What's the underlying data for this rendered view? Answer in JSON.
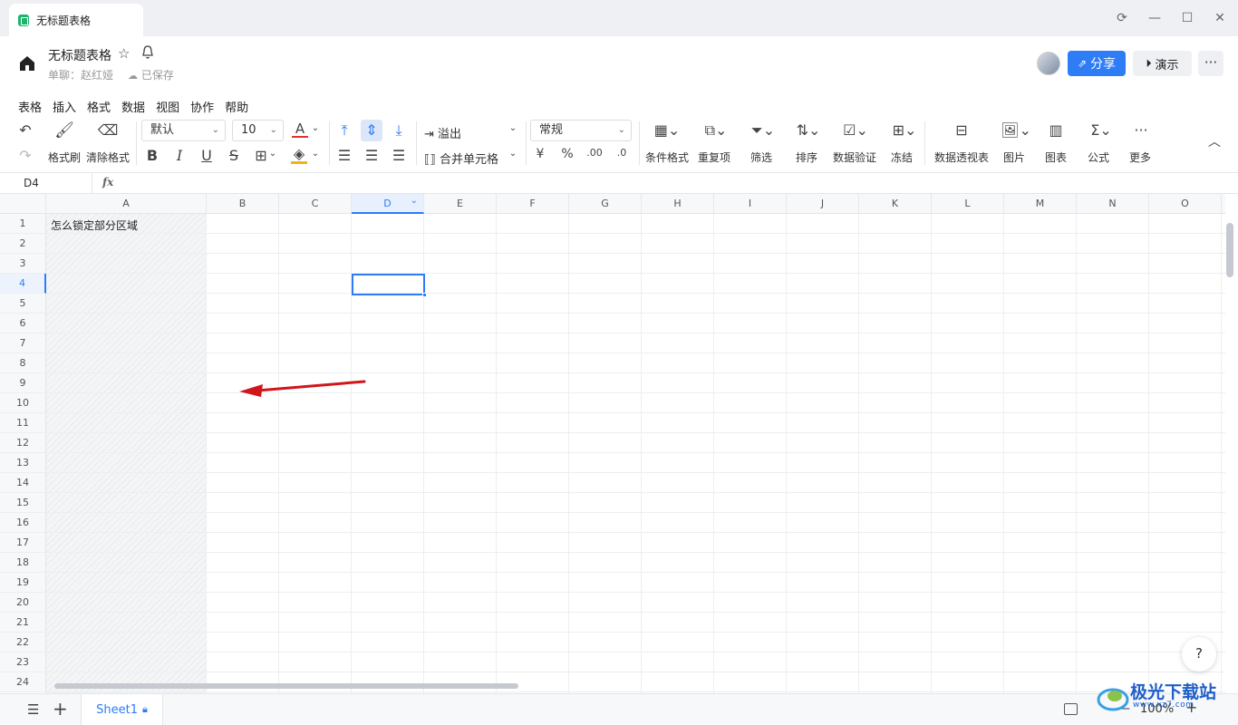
{
  "window": {
    "tab_title": "无标题表格",
    "controls": [
      "sync-icon",
      "minimize-icon",
      "maximize-icon",
      "close-icon"
    ]
  },
  "header": {
    "doc_title": "无标题表格",
    "owner": "单聊：赵红娅",
    "save_status": "已保存",
    "share_label": "分享",
    "present_label": "演示",
    "more_label": "···"
  },
  "menu": [
    "表格",
    "插入",
    "格式",
    "数据",
    "视图",
    "协作",
    "帮助"
  ],
  "toolbar": {
    "format_painter": "格式刷",
    "clear_format": "清除格式",
    "font_family": "默认",
    "font_size": "10",
    "overflow": "溢出",
    "merge": "合并单元格",
    "number_format": "常规",
    "currency": "¥",
    "percent": "%",
    "conditional_format": "条件格式",
    "duplicates": "重复项",
    "filter": "筛选",
    "sort": "排序",
    "data_validation": "数据验证",
    "freeze": "冻结",
    "pivot_table": "数据透视表",
    "image": "图片",
    "chart": "图表",
    "formula": "公式",
    "more": "更多",
    "font_color": "A"
  },
  "formula_bar": {
    "cell_ref": "D4",
    "fx": "fx",
    "value": ""
  },
  "sheet": {
    "columns": [
      "A",
      "B",
      "C",
      "D",
      "E",
      "F",
      "G",
      "H",
      "I",
      "J",
      "K",
      "L",
      "M",
      "N",
      "O"
    ],
    "rows": [
      "1",
      "2",
      "3",
      "4",
      "5",
      "6",
      "7",
      "8",
      "9",
      "10",
      "11",
      "12",
      "13",
      "14",
      "15",
      "16",
      "17",
      "18",
      "19",
      "20",
      "21",
      "22",
      "23",
      "24"
    ],
    "selected_cell": "D4",
    "frozen_columns": [
      "A"
    ],
    "cells": {
      "A1": "怎么锁定部分区域"
    }
  },
  "annotation": {
    "arrow_color": "#d0161b"
  },
  "bottom": {
    "sheet_name": "Sheet1",
    "zoom": "100%"
  },
  "watermark": {
    "text": "极光下载站",
    "url": "www.xz7.com"
  },
  "colors": {
    "accent": "#2e7cf6",
    "sheet_icon": "#1bb56c"
  }
}
